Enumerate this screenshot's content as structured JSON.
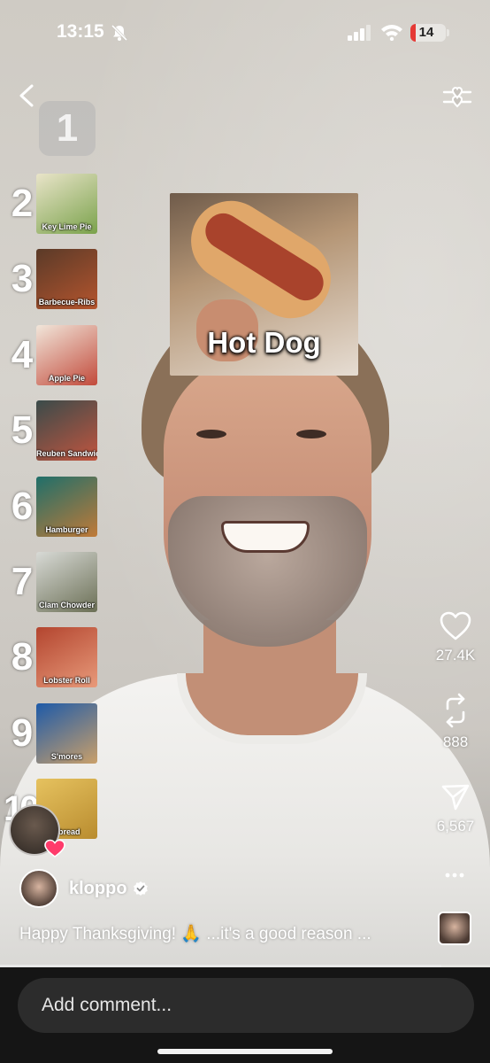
{
  "status_bar": {
    "time": "13:15",
    "battery": "14",
    "battery_level": 0.14
  },
  "ranking": {
    "slot_1": "1",
    "items": [
      {
        "rank": "2",
        "label": "Key Lime Pie",
        "colors": [
          "#e9e4c9",
          "#7aa24b"
        ]
      },
      {
        "rank": "3",
        "label": "Barbecue-Ribs",
        "colors": [
          "#5a3a28",
          "#b5552e"
        ]
      },
      {
        "rank": "4",
        "label": "Apple Pie",
        "colors": [
          "#f1e6da",
          "#c24a3b"
        ]
      },
      {
        "rank": "5",
        "label": "Reuben Sandwich",
        "colors": [
          "#3a4b4a",
          "#c2553f"
        ]
      },
      {
        "rank": "6",
        "label": "Hamburger",
        "colors": [
          "#1f6f6a",
          "#c07a38"
        ]
      },
      {
        "rank": "7",
        "label": "Clam Chowder",
        "colors": [
          "#d8dad6",
          "#6b6f55"
        ]
      },
      {
        "rank": "8",
        "label": "Lobster Roll",
        "colors": [
          "#b3452f",
          "#e89a7a"
        ]
      },
      {
        "rank": "9",
        "label": "S'mores",
        "colors": [
          "#1e5aa8",
          "#caa06a"
        ]
      },
      {
        "rank": "10",
        "label": "nbread",
        "colors": [
          "#e6c25f",
          "#b98c2f"
        ]
      }
    ]
  },
  "current_card": {
    "title": "Hot Dog"
  },
  "actions": {
    "likes": "27.4K",
    "reposts": "888",
    "shares": "6,567"
  },
  "post": {
    "author": "kloppo",
    "caption": "Happy Thanksgiving! 🙏 ...it's a good reason ..."
  },
  "playback": {
    "progress": 0.9
  },
  "comment": {
    "placeholder": "Add comment..."
  }
}
